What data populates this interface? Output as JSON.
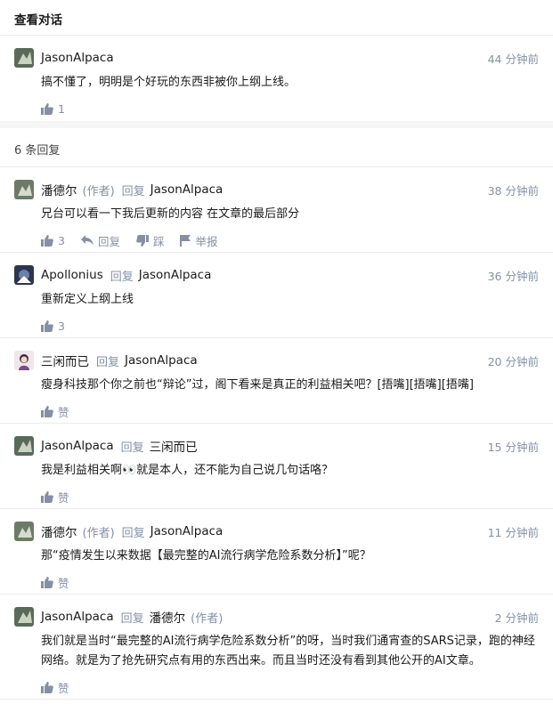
{
  "header": {
    "title": "查看对话"
  },
  "root": {
    "author": "JasonAlpaca",
    "time": "44 分钟前",
    "content": "搞不懂了，明明是个好玩的东西非被你上纲上线。",
    "likes": "1"
  },
  "reply_count": "6 条回复",
  "reply_word": "回复",
  "author_tag": "(作者)",
  "actions": {
    "reply": "回复",
    "dislike": "踩",
    "report": "举报",
    "like_zero": "赞"
  },
  "replies": [
    {
      "author": "潘德尔",
      "target": "JasonAlpaca",
      "time": "38 分钟前",
      "content": "兄台可以看一下我后更新的内容 在文章的最后部分",
      "likes": "3"
    },
    {
      "author": "Apollonius",
      "target": "JasonAlpaca",
      "time": "36 分钟前",
      "content": "重新定义上纲上线",
      "likes": "3"
    },
    {
      "author": "三闲而已",
      "target": "JasonAlpaca",
      "time": "20 分钟前",
      "content": "瘦身科技那个你之前也“辩论”过，阁下看来是真正的利益相关吧？[捂嘴][捂嘴][捂嘴]",
      "likes": "赞"
    },
    {
      "author": "JasonAlpaca",
      "target": "三闲而已",
      "time": "15 分钟前",
      "content": "我是利益相关啊👀就是本人，还不能为自己说几句话咯？",
      "likes": "赞"
    },
    {
      "author": "潘德尔",
      "target": "JasonAlpaca",
      "time": "11 分钟前",
      "content": "那“疫情发生以来数据【最完整的AI流行病学危险系数分析】”呢？",
      "likes": "赞"
    },
    {
      "author": "JasonAlpaca",
      "target": "潘德尔",
      "time": "2 分钟前",
      "content": "我们就是当时“最完整的AI流行病学危险系数分析”的呀，当时我们通宵查的SARS记录，跑的神经网络。就是为了抢先研究点有用的东西出来。而且当时还没有看到其他公开的AI文章。",
      "likes": "赞"
    }
  ],
  "colors": {
    "meta": "#8590a6",
    "divider": "#ebebeb",
    "band": "#f6f6f6"
  }
}
